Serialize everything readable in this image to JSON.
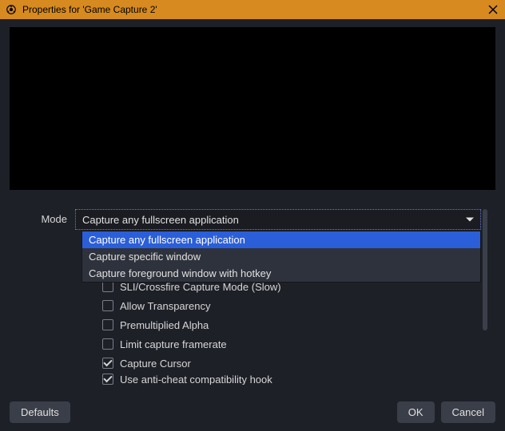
{
  "window": {
    "title": "Properties for 'Game Capture 2'"
  },
  "mode": {
    "label": "Mode",
    "selected": "Capture any fullscreen application",
    "options": [
      "Capture any fullscreen application",
      "Capture specific window",
      "Capture foreground window with hotkey"
    ]
  },
  "checks": {
    "sli": {
      "label": "SLI/Crossfire Capture Mode (Slow)",
      "checked": false
    },
    "transparency": {
      "label": "Allow Transparency",
      "checked": false
    },
    "premultiplied": {
      "label": "Premultiplied Alpha",
      "checked": false
    },
    "limit": {
      "label": "Limit capture framerate",
      "checked": false
    },
    "cursor": {
      "label": "Capture Cursor",
      "checked": true
    },
    "anticheat": {
      "label": "Use anti-cheat compatibility hook",
      "checked": true
    }
  },
  "buttons": {
    "defaults": "Defaults",
    "ok": "OK",
    "cancel": "Cancel"
  }
}
